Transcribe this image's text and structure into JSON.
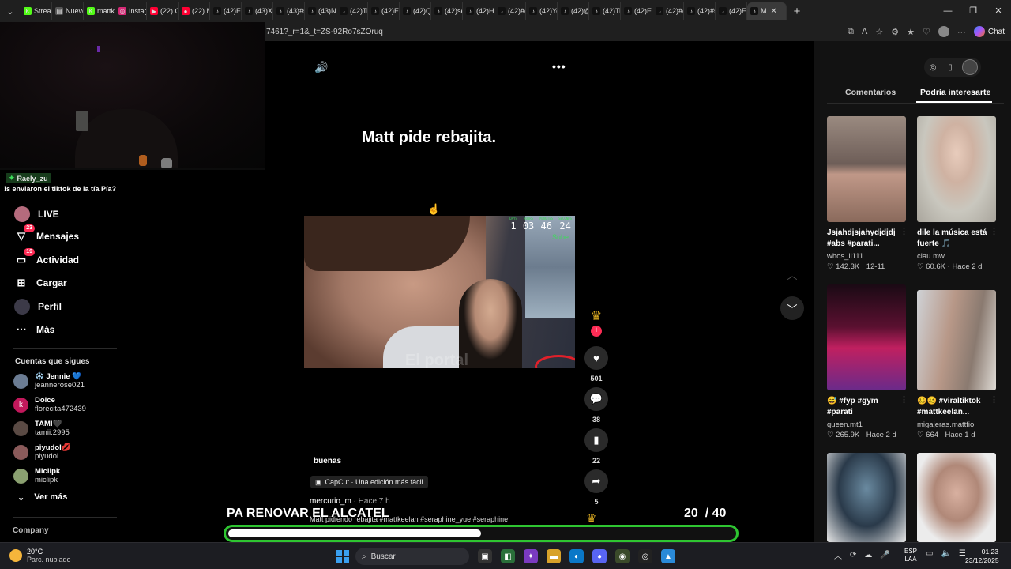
{
  "browser": {
    "tabs": [
      {
        "label": "Stream",
        "color": "#53fc18",
        "glyph": "K"
      },
      {
        "label": "Nuevo",
        "color": "#555",
        "glyph": "▤"
      },
      {
        "label": "mattk",
        "color": "#53fc18",
        "glyph": "K"
      },
      {
        "label": "Instag",
        "color": "#d62976",
        "glyph": "◎"
      },
      {
        "label": "(22) O",
        "color": "#ff0033",
        "glyph": "▶"
      },
      {
        "label": "(22) M",
        "color": "#ff0033",
        "glyph": "●"
      },
      {
        "label": "(42)Er",
        "color": "#111",
        "glyph": "♪"
      },
      {
        "label": "(43)XD",
        "color": "#111",
        "glyph": "♪"
      },
      {
        "label": "(43)#s",
        "color": "#111",
        "glyph": "♪"
      },
      {
        "label": "(43)Nu",
        "color": "#111",
        "glyph": "♪"
      },
      {
        "label": "(42)Ti",
        "color": "#111",
        "glyph": "♪"
      },
      {
        "label": "(42)Es",
        "color": "#111",
        "glyph": "♪"
      },
      {
        "label": "(42)Q",
        "color": "#111",
        "glyph": "♪"
      },
      {
        "label": "(42)se",
        "color": "#111",
        "glyph": "♪"
      },
      {
        "label": "(42)He",
        "color": "#111",
        "glyph": "♪"
      },
      {
        "label": "(42)#c",
        "color": "#111",
        "glyph": "♪"
      },
      {
        "label": "(42)Yo",
        "color": "#111",
        "glyph": "♪"
      },
      {
        "label": "(42)@",
        "color": "#111",
        "glyph": "♪"
      },
      {
        "label": "(42)Ti",
        "color": "#111",
        "glyph": "♪"
      },
      {
        "label": "(42)En",
        "color": "#111",
        "glyph": "♪"
      },
      {
        "label": "(42)#c",
        "color": "#111",
        "glyph": "♪"
      },
      {
        "label": "(42)#s",
        "color": "#111",
        "glyph": "♪"
      },
      {
        "label": "(42)El",
        "color": "#111",
        "glyph": "♪"
      }
    ],
    "active_tab": "M",
    "url": "7461?_r=1&_t=ZS-92Ro7sZOruq",
    "chat_label": "Chat"
  },
  "stream_chat": {
    "user": "Raely_zu",
    "message": "!s enviaron el tiktok de la tía Pía?"
  },
  "nav": {
    "live": "LIVE",
    "messages": "Mensajes",
    "messages_badge": "23",
    "activity": "Actividad",
    "activity_badge": "19",
    "upload": "Cargar",
    "profile": "Perfil",
    "more": "Más",
    "following_title": "Cuentas que sigues",
    "following": [
      {
        "name": "❄️ Jennie 💙",
        "handle": "jeannerose021",
        "color": "#6b7c93",
        "glyph": ""
      },
      {
        "name": "Dolce",
        "handle": "florecita472439",
        "color": "#c2185b",
        "glyph": "k"
      },
      {
        "name": "TAMI🖤",
        "handle": "tamii.2995",
        "color": "#5a4a44",
        "glyph": ""
      },
      {
        "name": "piyudol💋",
        "handle": "piyudol",
        "color": "#8a5a5a",
        "glyph": ""
      },
      {
        "name": "Miclipk",
        "handle": "miclipk",
        "color": "#8aa070",
        "glyph": ""
      }
    ],
    "see_more": "Ver más",
    "company": "Company"
  },
  "video": {
    "title": "Matt pide rebajita.",
    "timer": [
      {
        "label": "DAYS",
        "value": "1"
      },
      {
        "label": "HOURS",
        "value": "03"
      },
      {
        "label": "MINUTES",
        "value": "46"
      },
      {
        "label": "SECONDS",
        "value": "24"
      }
    ],
    "sube": "Sube",
    "caption": "El portal",
    "likes": "501",
    "comments": "38",
    "saves": "22",
    "shares": "5",
    "desc_top": "buenas",
    "capcut": "CapCut · Una edición más fácil",
    "author": "mercurio_m",
    "posted": " · Hace 7 h",
    "hashtags": "Matt pidiendo rebajita #mattkeelan #seraphine_yue #seraphine"
  },
  "right_panel": {
    "tab_comments": "Comentarios",
    "tab_suggested": "Podría interesarte",
    "cards": [
      {
        "title": "Jsjahdjsjahydjdjdj #abs #parati...",
        "user": "whos_li111",
        "likes": "142.3K",
        "time": "12-11"
      },
      {
        "title": "dile la música está fuerte 🎵",
        "user": "clau.mw",
        "likes": "60.6K",
        "time": "Hace 2 d"
      },
      {
        "title": "😅 #fyp #gym #parati",
        "user": "queen.mt1",
        "likes": "265.9K",
        "time": "Hace 2 d"
      },
      {
        "title": "🥴🥴 #viraltiktok #mattkeelan...",
        "user": "migajeras.mattfio",
        "likes": "664",
        "time": "Hace 1 d"
      }
    ]
  },
  "goal": {
    "text": "PA RENOVAR EL ALCATEL",
    "current": "20",
    "total": "/ 40",
    "progress": 0.5
  },
  "taskbar": {
    "temp": "20°C",
    "weather": "Parc. nublado",
    "search": "Buscar",
    "lang1": "ESP",
    "lang2": "LAA",
    "time": "01:23",
    "date": "23/12/2025"
  }
}
